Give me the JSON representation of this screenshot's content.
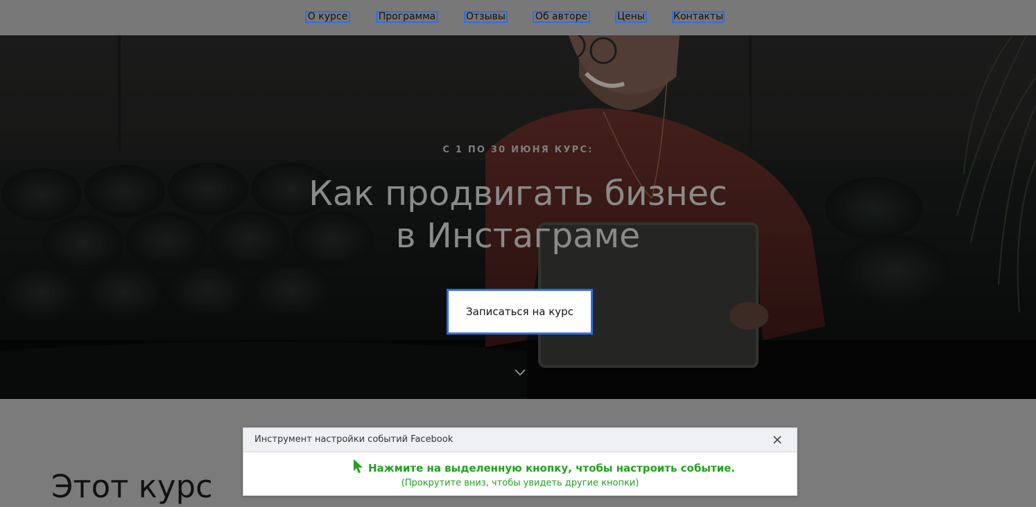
{
  "nav": {
    "items": [
      {
        "label": "О курсе"
      },
      {
        "label": "Программа"
      },
      {
        "label": "Отзывы"
      },
      {
        "label": "Об авторе"
      },
      {
        "label": "Цены"
      },
      {
        "label": "Контакты"
      }
    ],
    "highlight_color": "#2f6fe0"
  },
  "hero": {
    "subtitle": "С 1 ПО 30 ИЮНЯ КУРС:",
    "title_line1": "Как продвигать бизнес",
    "title_line2": "в Инстаграме",
    "cta_label": "Записаться на курс",
    "scroll_icon": "chevron-down-icon"
  },
  "about": {
    "heading": "Этот курс"
  },
  "fb_tool": {
    "title": "Инструмент настройки событий Facebook",
    "instruction": "Нажмите на выделенную кнопку, чтобы настроить событие.",
    "hint": "(Прокрутите вниз, чтобы увидеть другие кнопки)",
    "close_icon": "close-icon",
    "pointer_icon": "cursor-arrow-icon",
    "accent_color": "#22a01e"
  }
}
